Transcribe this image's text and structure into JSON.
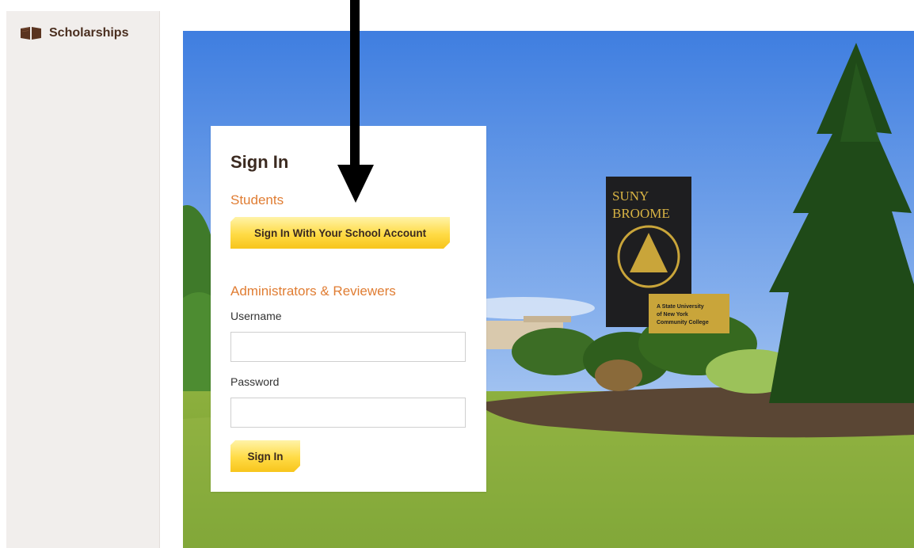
{
  "sidebar": {
    "brand_icon": "open-book-icon",
    "brand_label": "Scholarships"
  },
  "signin": {
    "title": "Sign In",
    "students_heading": "Students",
    "school_account_button": "Sign In With Your School Account",
    "admins_heading": "Administrators & Reviewers",
    "username_label": "Username",
    "username_value": "",
    "password_label": "Password",
    "password_value": "",
    "submit_button": "Sign In"
  },
  "hero": {
    "sign_line1": "SUNY",
    "sign_line2": "BROOME",
    "plaque_line1": "A State University",
    "plaque_line2": "of New York",
    "plaque_line3": "Community College"
  },
  "colors": {
    "accent_orange": "#e07d33",
    "button_gold": "#ffdb45",
    "brand_brown": "#4a2e1f",
    "sidebar_bg": "#f1eeec"
  }
}
